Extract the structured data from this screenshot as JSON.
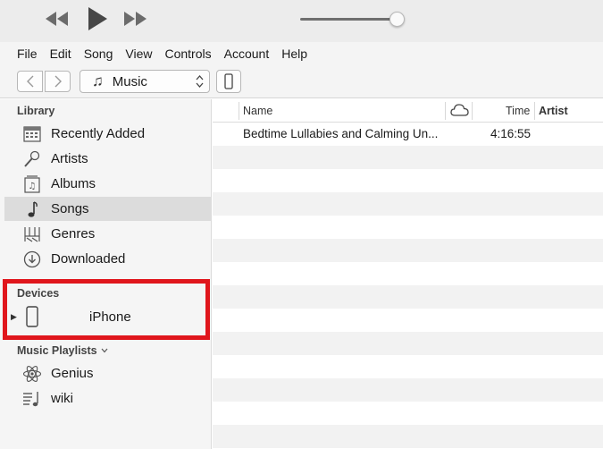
{
  "player": {
    "rewind_icon": "rewind-icon",
    "play_icon": "play-icon",
    "forward_icon": "fast-forward-icon",
    "volume_level": 0.92
  },
  "menu": [
    "File",
    "Edit",
    "Song",
    "View",
    "Controls",
    "Account",
    "Help"
  ],
  "toolbar": {
    "media_kind": "Music",
    "media_icon": "music-note-icon",
    "device_icon": "iphone-icon"
  },
  "sidebar": {
    "library_heading": "Library",
    "library_items": [
      {
        "label": "Recently Added",
        "icon": "calendar-grid-icon"
      },
      {
        "label": "Artists",
        "icon": "microphone-icon"
      },
      {
        "label": "Albums",
        "icon": "album-icon"
      },
      {
        "label": "Songs",
        "icon": "music-note-icon",
        "selected": true
      },
      {
        "label": "Genres",
        "icon": "genres-icon"
      },
      {
        "label": "Downloaded",
        "icon": "download-icon"
      }
    ],
    "devices_heading": "Devices",
    "device": {
      "label": "iPhone",
      "icon": "iphone-icon"
    },
    "playlists_heading": "Music Playlists",
    "playlists": [
      {
        "label": "Genius",
        "icon": "genius-atom-icon"
      },
      {
        "label": "wiki",
        "icon": "playlist-icon"
      }
    ]
  },
  "song_list": {
    "columns": {
      "name": "Name",
      "cloud": "cloud-icon",
      "time": "Time",
      "artist": "Artist"
    },
    "rows": [
      {
        "name": "Bedtime Lullabies and Calming Un...",
        "time": "4:16:55",
        "artist": ""
      }
    ]
  },
  "colors": {
    "highlight_border": "#e0161c",
    "selected_row": "#dcdcdc"
  }
}
